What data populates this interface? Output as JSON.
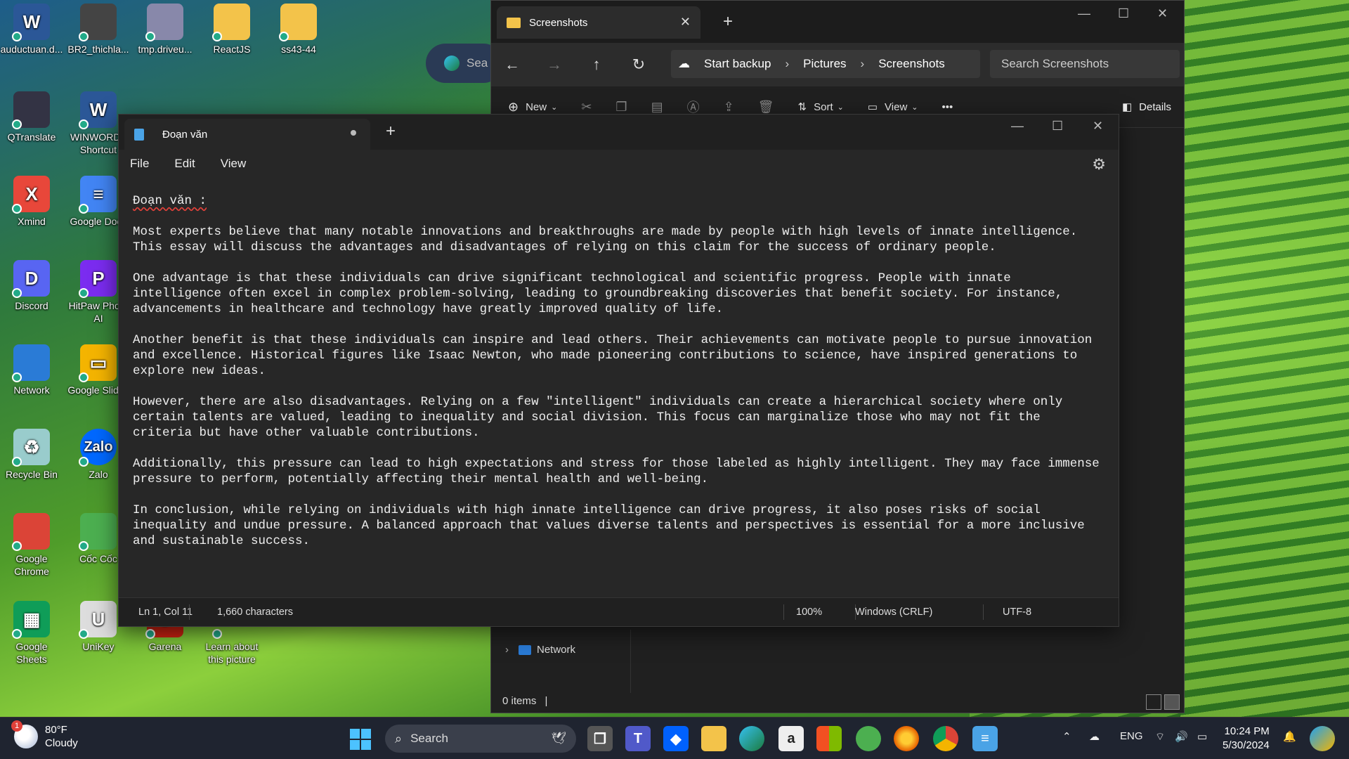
{
  "desktop": {
    "icons": [
      {
        "label": "auductuan.d...",
        "glyph": "W",
        "color": "#2b5797",
        "icon": "word-doc-icon"
      },
      {
        "label": "BR2_thichla...",
        "glyph": "",
        "color": "#444",
        "icon": "image-file-icon"
      },
      {
        "label": "tmp.driveu...",
        "glyph": "",
        "color": "#88a",
        "icon": "file-icon"
      },
      {
        "label": "ReactJS",
        "glyph": "",
        "color": "#f3c34a",
        "icon": "folder-icon"
      },
      {
        "label": "ss43-44",
        "glyph": "",
        "color": "#f3c34a",
        "icon": "folder-icon"
      },
      {
        "label": "QTranslate",
        "glyph": "",
        "color": "#334",
        "icon": "qtranslate-icon"
      },
      {
        "label": "WINWORD - Shortcut",
        "glyph": "W",
        "color": "#2b5797",
        "icon": "word-shortcut-icon"
      },
      {
        "label": "Xmind",
        "glyph": "X",
        "color": "#e8473a",
        "icon": "xmind-icon"
      },
      {
        "label": "Google Docs",
        "glyph": "≡",
        "color": "#4285f4",
        "icon": "google-docs-icon"
      },
      {
        "label": "Discord",
        "glyph": "D",
        "color": "#5865f2",
        "icon": "discord-icon"
      },
      {
        "label": "HitPaw Photo AI",
        "glyph": "P",
        "color": "#7b2cf0",
        "icon": "hitpaw-icon"
      },
      {
        "label": "Network",
        "glyph": "",
        "color": "#2a7bd6",
        "icon": "network-icon"
      },
      {
        "label": "Google Slides",
        "glyph": "▭",
        "color": "#f4b400",
        "icon": "google-slides-icon"
      },
      {
        "label": "Recycle Bin",
        "glyph": "♻",
        "color": "#9cc",
        "icon": "recycle-bin-icon"
      },
      {
        "label": "Zalo",
        "glyph": "Zalo",
        "color": "#0068ff",
        "icon": "zalo-icon"
      },
      {
        "label": "Google Chrome",
        "glyph": "",
        "color": "#db4437",
        "icon": "chrome-icon"
      },
      {
        "label": "Cốc Cốc",
        "glyph": "",
        "color": "#4caf50",
        "icon": "coccoc-icon"
      },
      {
        "label": "Google Sheets",
        "glyph": "▦",
        "color": "#0f9d58",
        "icon": "google-sheets-icon"
      },
      {
        "label": "UniKey",
        "glyph": "U",
        "color": "#ddd",
        "icon": "unikey-icon"
      },
      {
        "label": "Garena",
        "glyph": "G",
        "color": "#c21",
        "icon": "garena-icon"
      },
      {
        "label": "Learn about this picture",
        "glyph": "",
        "color": "transparent",
        "icon": "learn-picture-icon"
      }
    ]
  },
  "explorer": {
    "tab_title": "Screenshots",
    "backup_label": "Start backup",
    "crumbs": [
      "Pictures",
      "Screenshots"
    ],
    "search_placeholder": "Search Screenshots",
    "toolbar": {
      "new_label": "New",
      "sort_label": "Sort",
      "view_label": "View",
      "details_label": "Details"
    },
    "nav_network_label": "Network",
    "status": "0 items"
  },
  "notepad": {
    "tab_title": "Đoạn văn",
    "menu": {
      "file": "File",
      "edit": "Edit",
      "view": "View"
    },
    "heading": "Đoạn văn :",
    "paragraphs": [
      "Most experts believe that many notable innovations and breakthroughs are made by people with high levels of innate intelligence. This essay will discuss the advantages and disadvantages of relying on this claim for the success of ordinary people.",
      "One advantage is that these individuals can drive significant technological and scientific progress. People with innate intelligence often excel in complex problem-solving, leading to groundbreaking discoveries that benefit society. For instance, advancements in healthcare and technology have greatly improved quality of life.",
      "Another benefit is that these individuals can inspire and lead others. Their achievements can motivate people to pursue innovation and excellence. Historical figures like Isaac Newton, who made pioneering contributions to science, have inspired generations to explore new ideas.",
      "However, there are also disadvantages. Relying on a few \"intelligent\" individuals can create a hierarchical society where only certain talents are valued, leading to inequality and social division. This focus can marginalize those who may not fit the criteria but have other valuable contributions.",
      "Additionally, this pressure can lead to high expectations and stress for those labeled as highly intelligent. They may face immense pressure to perform, potentially affecting their mental health and well-being.",
      "In conclusion, while relying on individuals with high innate intelligence can drive progress, it also poses risks of social inequality and undue pressure. A balanced approach that values diverse talents and perspectives is essential for a more inclusive and sustainable success."
    ],
    "status": {
      "position": "Ln 1, Col 11",
      "chars": "1,660 characters",
      "zoom": "100%",
      "line_ending": "Windows (CRLF)",
      "encoding": "UTF-8"
    }
  },
  "taskbar": {
    "weather_temp": "80°F",
    "weather_desc": "Cloudy",
    "weather_badge": "1",
    "search_label": "Search",
    "language": "ENG",
    "time": "10:24 PM",
    "date": "5/30/2024"
  },
  "edge_search_partial": "Sea"
}
